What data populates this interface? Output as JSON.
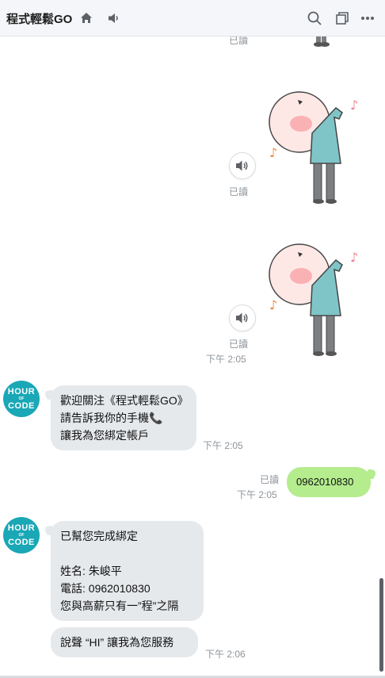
{
  "header": {
    "title": "程式輕鬆GO",
    "icons": [
      "home-icon",
      "speaker-icon",
      "search-icon",
      "notes-icon",
      "more-icon"
    ]
  },
  "messages": {
    "top_read": "已讀",
    "sticker1": {
      "read": "已讀"
    },
    "sticker2": {
      "read": "已讀",
      "time": "下午 2:05"
    },
    "bot1": {
      "avatar": {
        "line1": "HOUR",
        "line2": "OF",
        "line3": "CODE"
      },
      "lines": [
        "歡迎關注《程式輕鬆GO》",
        "請告訴我你的手機📞",
        "讓我為您綁定帳戶"
      ],
      "time": "下午 2:05"
    },
    "user1": {
      "text": "0962010830",
      "read": "已讀",
      "time": "下午 2:05"
    },
    "bot2": {
      "avatar": {
        "line1": "HOUR",
        "line2": "OF",
        "line3": "CODE"
      },
      "lines": [
        "已幫您完成綁定",
        "",
        "姓名: 朱峻平",
        "電話: 0962010830",
        "您與高薪只有一”程”之隔"
      ],
      "extra": "說聲 “HI” 讓我為您服務",
      "time": "下午 2:06"
    }
  },
  "colors": {
    "header_bg": "#f4f6f9",
    "bubble_in": "#e6e9ec",
    "bubble_out": "#b5ec8e",
    "avatar": "#1aa7b6"
  }
}
